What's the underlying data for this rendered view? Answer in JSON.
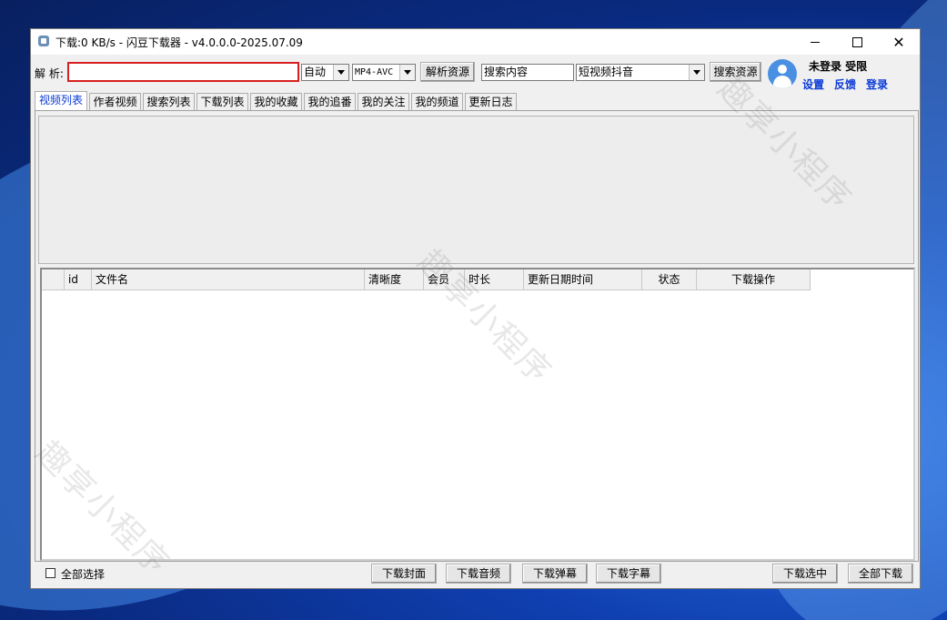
{
  "window": {
    "title": "下载:0 KB/s - 闪豆下载器 - v4.0.0.0-2025.07.09",
    "controls": {
      "minimize": "minimize-icon",
      "maximize": "maximize-icon",
      "close": "close-icon"
    }
  },
  "parse_row": {
    "label": "解 析:",
    "url_value": "",
    "mode_selected": "自动",
    "format_selected": "MP4-AVC",
    "parse_button": "解析资源",
    "search_placeholder": "搜索内容",
    "platform_selected": "短视频抖音",
    "search_button": "搜索资源"
  },
  "user": {
    "status": "未登录  受限",
    "settings": "设置",
    "feedback": "反馈",
    "login": "登录"
  },
  "tabs": [
    {
      "label": "视频列表",
      "active": true
    },
    {
      "label": "作者视频"
    },
    {
      "label": "搜索列表"
    },
    {
      "label": "下载列表"
    },
    {
      "label": "我的收藏"
    },
    {
      "label": "我的追番"
    },
    {
      "label": "我的关注"
    },
    {
      "label": "我的频道"
    },
    {
      "label": "更新日志"
    }
  ],
  "table": {
    "columns": [
      "",
      "id",
      "文件名",
      "清晰度",
      "会员",
      "时长",
      "更新日期时间",
      "状态",
      "下载操作"
    ],
    "rows": []
  },
  "footer": {
    "select_all": "全部选择",
    "download_cover": "下载封面",
    "download_audio": "下载音频",
    "download_danmaku": "下载弹幕",
    "download_subtitle": "下载字幕",
    "download_selected": "下载选中",
    "download_all": "全部下载"
  },
  "watermark": "趣享小程序"
}
